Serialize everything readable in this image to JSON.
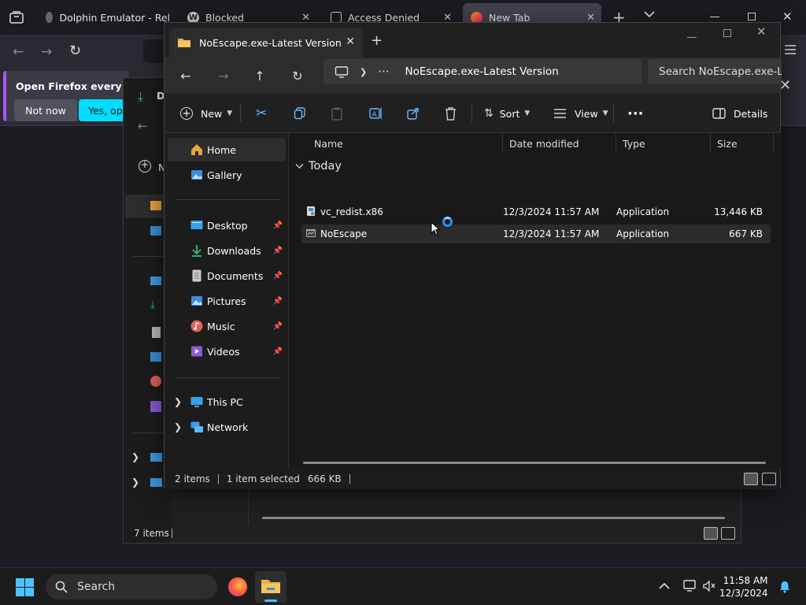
{
  "firefox": {
    "tabs": [
      {
        "title": "Dolphin Emulator - Rel"
      },
      {
        "title": "Blocked"
      },
      {
        "title": "Access Denied"
      },
      {
        "title": "New Tab"
      }
    ],
    "banner": {
      "text": "Open Firefox every time",
      "not_now": "Not now",
      "yes": "Yes, open"
    }
  },
  "bg_explorer": {
    "title_char": "D",
    "new_char": "N",
    "status": "7 items"
  },
  "explorer": {
    "tab_title": "NoEscape.exe-Latest Version",
    "address": {
      "ellipsis": "···",
      "path": "NoEscape.exe-Latest Version"
    },
    "search_placeholder": "Search NoEscape.exe-Lat",
    "toolbar": {
      "new_label": "New",
      "sort_label": "Sort",
      "view_label": "View",
      "more_label": "···",
      "details_label": "Details"
    },
    "nav": {
      "home": "Home",
      "gallery": "Gallery",
      "desktop": "Desktop",
      "downloads": "Downloads",
      "documents": "Documents",
      "pictures": "Pictures",
      "music": "Music",
      "videos": "Videos",
      "this_pc": "This PC",
      "network": "Network"
    },
    "columns": {
      "name": "Name",
      "date": "Date modified",
      "type": "Type",
      "size": "Size"
    },
    "group": "Today",
    "files": [
      {
        "name": "vc_redist.x86",
        "date": "12/3/2024 11:57 AM",
        "type": "Application",
        "size": "13,446 KB"
      },
      {
        "name": "NoEscape",
        "date": "12/3/2024 11:57 AM",
        "type": "Application",
        "size": "667 KB"
      }
    ],
    "status": {
      "count": "2 items",
      "selected": "1 item selected",
      "size": "666 KB"
    }
  },
  "taskbar": {
    "search": "Search",
    "time": "11:58 AM",
    "date": "12/3/2024"
  },
  "colors": {
    "accent": "#0078d4",
    "firefox_cyan": "#00ddff",
    "folder": "#e8b04a"
  }
}
